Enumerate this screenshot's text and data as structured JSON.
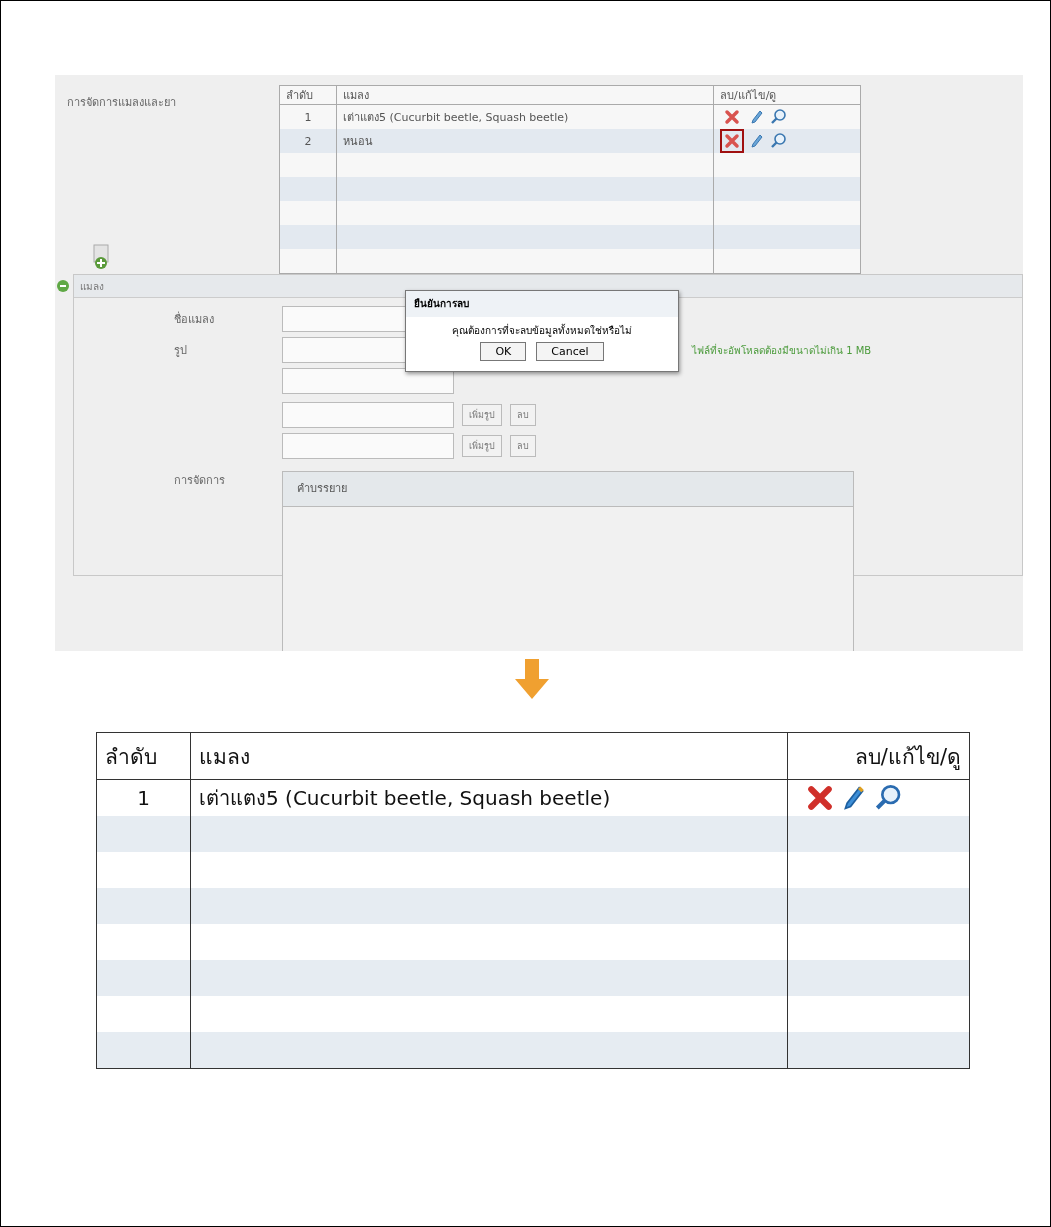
{
  "top_screenshot": {
    "section_label": "การจัดการแมลงและยา",
    "table": {
      "columns": [
        "ลำดับ",
        "แมลง",
        "ลบ/แก้ไข/ดู"
      ],
      "rows": [
        {
          "number": "1",
          "name": "เต่าแตง5 (Cucurbit beetle, Squash beetle)",
          "delete_highlighted": false
        },
        {
          "number": "2",
          "name": "หนอน",
          "delete_highlighted": true
        }
      ]
    },
    "panel": {
      "title": "แมลง",
      "expanded": true,
      "name_label": "ชื่อแมลง",
      "image_label": "รูป",
      "image_note": "ไฟล์ที่จะอัพโหลดต้องมีขนาดไม่เกิน 1 MB",
      "image_rows": [
        {
          "add": "เพิ่มรูป",
          "remove": "ลบ"
        },
        {
          "add": "เพิ่มรูป",
          "remove": "ลบ"
        }
      ],
      "manage_label": "การจัดการ",
      "description_header": "คำบรรยาย"
    },
    "dialog": {
      "title": "ยืนยันการลบ",
      "message": "คุณต้องการที่จะลบข้อมูลทั้งหมดใช่หรือไม่",
      "buttons": [
        "OK",
        "Cancel"
      ]
    }
  },
  "bottom_table": {
    "columns": [
      "ลำดับ",
      "แมลง",
      "ลบ/แก้ไข/ดู"
    ],
    "rows": [
      {
        "number": "1",
        "name": "เต่าแตง5 (Cucurbit beetle, Squash beetle)"
      }
    ]
  }
}
